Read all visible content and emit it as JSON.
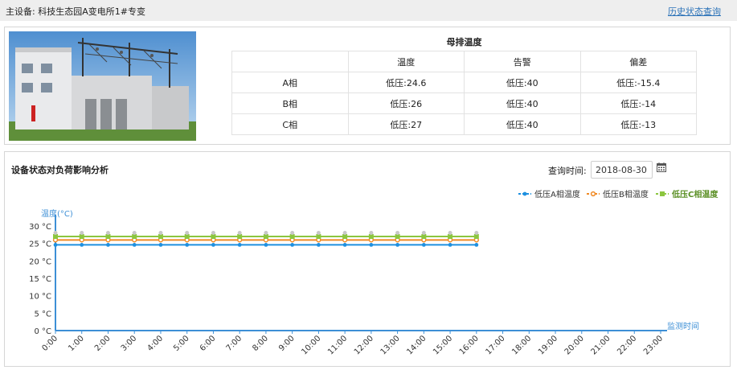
{
  "header": {
    "device_title": "主设备: 科技生态园A变电所1#专变",
    "history_link": "历史状态查询"
  },
  "busbar": {
    "caption": "母排温度",
    "columns": [
      "",
      "温度",
      "告警",
      "偏差"
    ],
    "rows": [
      {
        "phase": "A相",
        "temp": "低压:24.6",
        "alarm": "低压:40",
        "diff": "低压:-15.4"
      },
      {
        "phase": "B相",
        "temp": "低压:26",
        "alarm": "低压:40",
        "diff": "低压:-14"
      },
      {
        "phase": "C相",
        "temp": "低压:27",
        "alarm": "低压:40",
        "diff": "低压:-13"
      }
    ]
  },
  "analysis": {
    "title": "设备状态对负荷影响分析",
    "query_label": "查询时间:",
    "query_date": "2018-08-30"
  },
  "colors": {
    "series_a": "#1e90e0",
    "series_b": "#f08a24",
    "series_c": "#8cc63f",
    "axis": "#3d8fd6"
  },
  "chart_data": {
    "type": "line",
    "ylabel": "温度(°C)",
    "xlabel": "监测时间",
    "y_ticks": [
      "0 °C",
      "5 °C",
      "10 °C",
      "15 °C",
      "20 °C",
      "25 °C",
      "30 °C"
    ],
    "y_tick_values": [
      0,
      5,
      10,
      15,
      20,
      25,
      30
    ],
    "ylim": [
      0,
      30
    ],
    "categories": [
      "0:00",
      "1:00",
      "2:00",
      "3:00",
      "4:00",
      "5:00",
      "6:00",
      "7:00",
      "8:00",
      "9:00",
      "10:00",
      "11:00",
      "12:00",
      "13:00",
      "14:00",
      "15:00",
      "16:00",
      "17:00",
      "18:00",
      "19:00",
      "20:00",
      "21:00",
      "22:00",
      "23:00"
    ],
    "legend_position": "top-right",
    "series": [
      {
        "name": "低压A相温度",
        "values": [
          24.6,
          24.6,
          24.6,
          24.6,
          24.6,
          24.6,
          24.6,
          24.6,
          24.6,
          24.6,
          24.6,
          24.6,
          24.6,
          24.6,
          24.6,
          24.6,
          24.6
        ]
      },
      {
        "name": "低压B相温度",
        "values": [
          26,
          26,
          26,
          26,
          26,
          26,
          26,
          26,
          26,
          26,
          26,
          26,
          26,
          26,
          26,
          26,
          26
        ]
      },
      {
        "name": "低压C相温度",
        "values": [
          27,
          27,
          27,
          27,
          27,
          27,
          27,
          27,
          27,
          27,
          27,
          27,
          27,
          27,
          27,
          27,
          27
        ]
      }
    ]
  }
}
